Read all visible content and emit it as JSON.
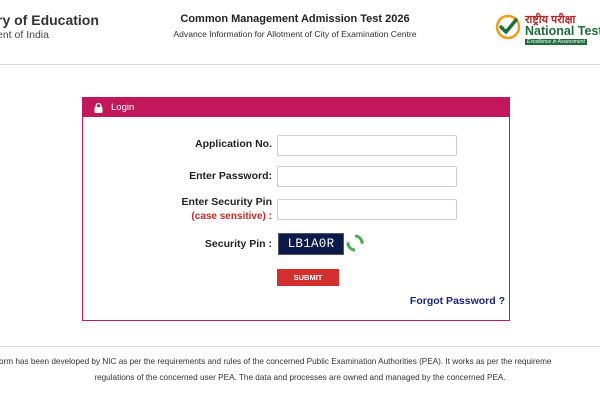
{
  "header": {
    "ministry_title": "ry of Education",
    "ministry_subtitle": "ent of India",
    "exam_title": "Common Management Admission Test 2026",
    "exam_subtitle": "Advance Information for Allotment of City of Examination Centre",
    "nta_hindi": "राष्ट्रीय परीक्षा",
    "nta_english": "National Test",
    "nta_tagline": "Excellence in Assessment"
  },
  "login": {
    "title": "Login",
    "application_label": "Application No.",
    "application_value": "",
    "password_label": "Enter Password:",
    "password_value": "",
    "security_pin_label": "Enter Security Pin",
    "case_sensitive_note": "(case sensitive) :",
    "security_pin_value": "",
    "security_pin_display_label": "Security Pin :",
    "captcha_text": "LB1A0R",
    "submit_label": "SUBMIT",
    "forgot_password_label": "Forgot Password ?"
  },
  "footer": {
    "line1": "orm has been developed by NIC as per the requirements and rules of the concerned Public Examination Authorities (PEA). It works as per the requireme",
    "line2": "regulations of the concerned user PEA. The data and processes are owned and managed by the concerned PEA."
  },
  "colors": {
    "accent": "#c2185b",
    "submit": "#d32f2f",
    "link": "#1a237e",
    "captcha_bg": "#0b1a4a"
  },
  "icons": [
    "lock-icon",
    "refresh-icon",
    "nta-logo-icon"
  ]
}
